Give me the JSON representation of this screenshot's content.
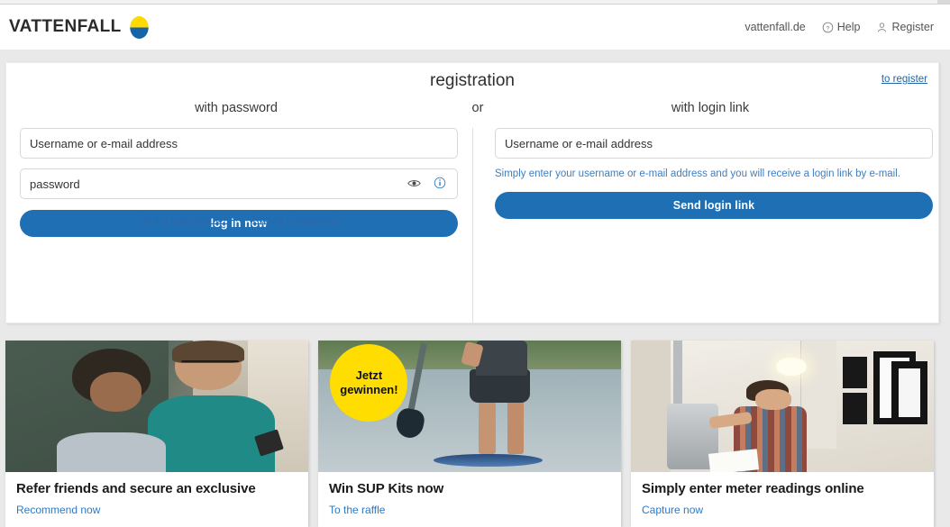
{
  "header": {
    "logo_text": "VATTENFALL",
    "nav": [
      {
        "label": "vattenfall.de",
        "icon": ""
      },
      {
        "label": "Help",
        "icon": "question-circle-icon"
      },
      {
        "label": "Register",
        "icon": "user-icon"
      }
    ]
  },
  "login": {
    "title": "registration",
    "to_register_label": "to register",
    "left_subhead": "with password",
    "or_label": "or",
    "right_subhead": "with login link",
    "username_placeholder": "Username or e-mail address",
    "password_placeholder": "password",
    "login_button": "log in now",
    "forgot_username": "Forgot Username?",
    "forgot_password": "Forgot Password?",
    "link_username_placeholder": "Username or e-mail address",
    "link_helper": "Simply enter your username or e-mail address and you will receive a login link by e-mail.",
    "send_link_button": "Send login link",
    "accent_blue": "#1f6fb5",
    "link_blue": "#2a68ab"
  },
  "promos": [
    {
      "title": "Refer friends and secure an exclusive",
      "link": "Recommend now",
      "badge": ""
    },
    {
      "title": "Win SUP Kits now",
      "link": "To the raffle",
      "badge": "Jetzt\ngewinnen!"
    },
    {
      "title": "Simply enter meter readings online",
      "link": "Capture now",
      "badge": ""
    }
  ]
}
